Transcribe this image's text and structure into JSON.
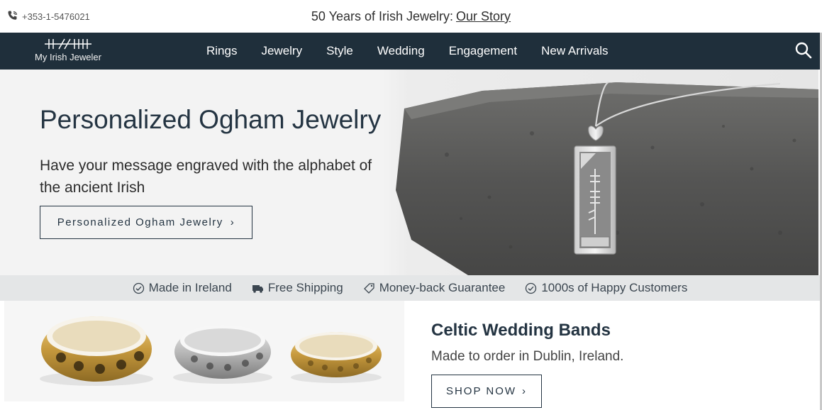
{
  "topbar": {
    "phone": "+353-1-5476021",
    "announce_text": "50 Years of Irish Jewelry:",
    "announce_link": "Our Story"
  },
  "nav": {
    "logo_text": "My Irish Jeweler",
    "items": [
      "Rings",
      "Jewelry",
      "Style",
      "Wedding",
      "Engagement",
      "New Arrivals"
    ]
  },
  "hero": {
    "title": "Personalized Ogham Jewelry",
    "subtitle": "Have your message engraved with the alphabet of the ancient Irish",
    "button_label": "Personalized Ogham Jewelry"
  },
  "trust": {
    "items": [
      "Made in Ireland",
      "Free Shipping",
      "Money-back Guarantee",
      "1000s of Happy Customers"
    ]
  },
  "promo": {
    "title": "Celtic Wedding Bands",
    "subtitle": "Made to order in Dublin, Ireland.",
    "button_label": "SHOP NOW"
  },
  "colors": {
    "nav_bg": "#1f2f3b",
    "heading": "#243442",
    "trust_bg": "#e4e6e7"
  }
}
